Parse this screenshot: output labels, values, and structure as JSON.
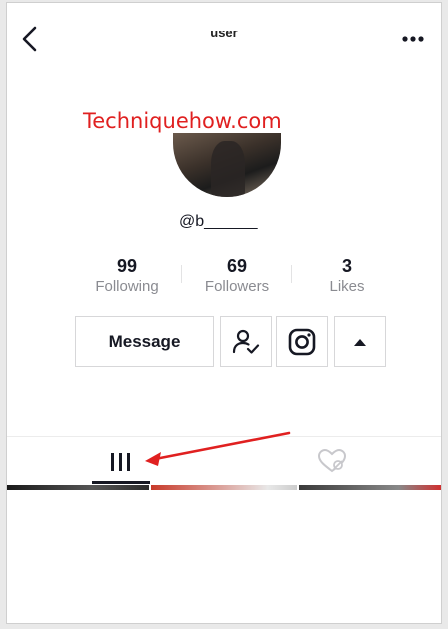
{
  "header": {
    "title": "user",
    "back_icon": "chevron-left-icon",
    "more_icon": "more-horizontal-icon"
  },
  "watermark": "Techniquehow.com",
  "profile": {
    "username": "@b______"
  },
  "stats": [
    {
      "value": "99",
      "label": "Following"
    },
    {
      "value": "69",
      "label": "Followers"
    },
    {
      "value": "3",
      "label": "Likes"
    }
  ],
  "actions": {
    "message_label": "Message",
    "follow_icon": "user-check-icon",
    "instagram_icon": "instagram-icon",
    "more_icon": "triangle-up-icon"
  },
  "tabs": {
    "videos_icon": "grid-bars-icon",
    "liked_icon": "heart-hidden-icon"
  },
  "colors": {
    "text_primary": "#161823",
    "text_secondary": "#8a8b91",
    "annotation_red": "#e02020",
    "border": "#d7d7d9"
  }
}
